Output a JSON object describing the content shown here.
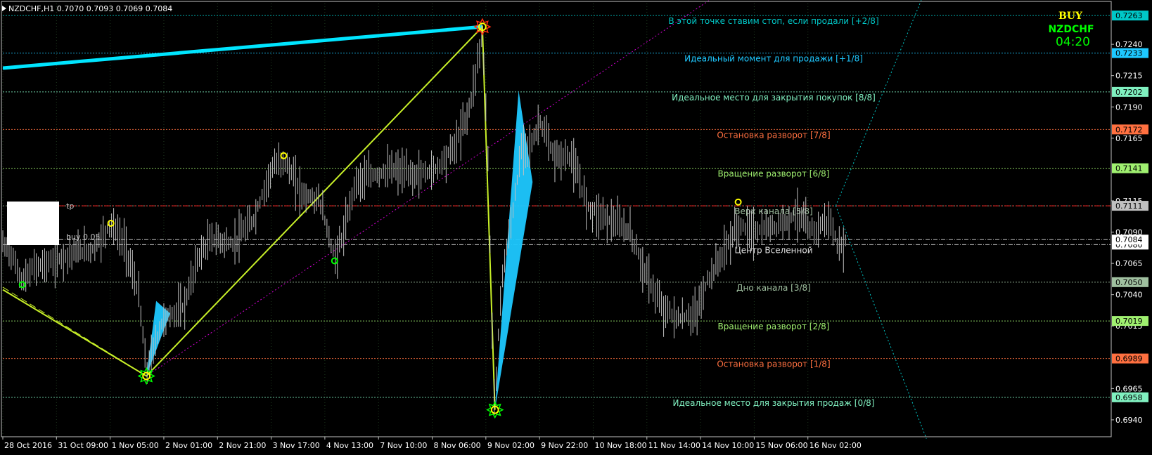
{
  "header": {
    "title": "NZDCHF,H1  0.7070 0.7093 0.7069 0.7084"
  },
  "signal": {
    "action": "BUY",
    "symbol": "NZDCHF",
    "timer": "04:20"
  },
  "trade_labels": {
    "tp": "tp",
    "buy": "buy 0.05"
  },
  "colors": {
    "background": "#000000",
    "bull_candle": "#c0c0c0",
    "grid": "#1f3a1f",
    "cyan": "#00e5ff",
    "sky": "#1ec8ff",
    "lime": "#c8f028",
    "orange": "#ff7040",
    "green_label": "#a0f070",
    "teal": "#00c8c8",
    "magenta": "#d000d0",
    "yellow": "#ffff00",
    "sig_green": "#00ff00",
    "buy_yellow": "#ffff00",
    "nzd_green": "#00ff00"
  },
  "chart_data": {
    "type": "line",
    "title": "NZDCHF,H1",
    "ylim": [
      0.69265,
      0.72726
    ],
    "x_range": [
      0,
      1237
    ],
    "x_tick_labels": [
      {
        "x": 0,
        "label": "28 Oct 2016"
      },
      {
        "x": 77,
        "label": "31 Oct 09:00"
      },
      {
        "x": 154,
        "label": "1 Nov 05:00"
      },
      {
        "x": 231,
        "label": "2 Nov 01:00"
      },
      {
        "x": 308,
        "label": "2 Nov 21:00"
      },
      {
        "x": 385,
        "label": "3 Nov 17:00"
      },
      {
        "x": 462,
        "label": "4 Nov 13:00"
      },
      {
        "x": 539,
        "label": "7 Nov 10:00"
      },
      {
        "x": 616,
        "label": "8 Nov 06:00"
      },
      {
        "x": 693,
        "label": "9 Nov 02:00"
      },
      {
        "x": 770,
        "label": "9 Nov 22:00"
      },
      {
        "x": 847,
        "label": "10 Nov 18:00"
      },
      {
        "x": 924,
        "label": "11 Nov 14:00"
      },
      {
        "x": 1001,
        "label": "14 Nov 10:00"
      },
      {
        "x": 1078,
        "label": "15 Nov 06:00"
      },
      {
        "x": 1155,
        "label": "16 Nov 02:00"
      }
    ],
    "y_tick_labels": [
      {
        "value": 0.724,
        "label": "0.7240"
      },
      {
        "value": 0.7215,
        "label": "0.7215"
      },
      {
        "value": 0.719,
        "label": "0.7190"
      },
      {
        "value": 0.7165,
        "label": "0.7165"
      },
      {
        "value": 0.7115,
        "label": "0.7115"
      },
      {
        "value": 0.709,
        "label": "0.7090"
      },
      {
        "value": 0.7065,
        "label": "0.7065"
      },
      {
        "value": 0.704,
        "label": "0.7040"
      },
      {
        "value": 0.7015,
        "label": "0.7015"
      },
      {
        "value": 0.6965,
        "label": "0.6965"
      },
      {
        "value": 0.694,
        "label": "0.6940"
      }
    ],
    "murrey_levels": [
      {
        "value": 0.7263,
        "label": "0.7263",
        "text": "В этой точке ставим стоп, если продали [+2/8]",
        "color": "#00c8c8",
        "tag_bg": "#00c8c8",
        "tag_fg": "#000000"
      },
      {
        "value": 0.7233,
        "label": "0.7233",
        "text": "Идеальный момент для продажи [+1/8]",
        "color": "#1ec8ff",
        "tag_bg": "#1ec8ff",
        "tag_fg": "#000000"
      },
      {
        "value": 0.7202,
        "label": "0.7202",
        "text": "Идеальное место для закрытия покупок [8/8]",
        "color": "#80f0c0",
        "tag_bg": "#80f0c0",
        "tag_fg": "#000000"
      },
      {
        "value": 0.7172,
        "label": "0.7172",
        "text": "Остановка разворот [7/8]",
        "color": "#ff7040",
        "tag_bg": "#ff7040",
        "tag_fg": "#000000"
      },
      {
        "value": 0.7141,
        "label": "0.7141",
        "text": "Вращение разворот [6/8]",
        "color": "#a0f070",
        "tag_bg": "#a0f070",
        "tag_fg": "#000000"
      },
      {
        "value": 0.7111,
        "label": "0.7111",
        "text": "Верх канала [5/8]",
        "color": "#a0c0a0",
        "tag_bg": "#c0c0c0",
        "tag_fg": "#000000"
      },
      {
        "value": 0.708,
        "label": "0.7080",
        "text": "Центр Вселенной",
        "color": "#e0e0e0",
        "tag_bg": "#ffffff",
        "tag_fg": "#000000"
      },
      {
        "value": 0.705,
        "label": "0.7050",
        "text": "Дно канала [3/8]",
        "color": "#a0c0a0",
        "tag_bg": "#a0c0a0",
        "tag_fg": "#000000"
      },
      {
        "value": 0.7019,
        "label": "0.7019",
        "text": "Вращение разворот [2/8]",
        "color": "#a0f070",
        "tag_bg": "#a0f070",
        "tag_fg": "#000000"
      },
      {
        "value": 0.6989,
        "label": "0.6989",
        "text": "Остановка разворот [1/8]",
        "color": "#ff7040",
        "tag_bg": "#ff7040",
        "tag_fg": "#000000"
      },
      {
        "value": 0.6958,
        "label": "0.6958",
        "text": "Идеальное место для закрытия продаж [0/8]",
        "color": "#80f0c0",
        "tag_bg": "#80f0c0",
        "tag_fg": "#000000"
      }
    ],
    "tp_level": 0.7111,
    "current_price": {
      "value": 0.7084,
      "label": "0.7084"
    },
    "zigzag": [
      {
        "x": 0,
        "y": 0.7044
      },
      {
        "x": 206,
        "y": 0.6975
      },
      {
        "x": 688,
        "y": 0.7254
      },
      {
        "x": 706,
        "y": 0.6948
      }
    ],
    "zigzag_dashed": [
      {
        "x": 0,
        "y": 0.7046
      },
      {
        "x": 206,
        "y": 0.6975
      }
    ],
    "trend_upper": [
      {
        "x": 0,
        "y": 0.7221
      },
      {
        "x": 688,
        "y": 0.7254
      }
    ],
    "magenta_channel": [
      {
        "x": 206,
        "y": 0.6975
      },
      {
        "x": 1040,
        "y": 0.7285
      }
    ],
    "teal_dotted": [
      {
        "x": 1195,
        "y": 0.7111
      },
      {
        "x": 1325,
        "y": 0.7285
      }
    ],
    "teal_dotted_down": [
      {
        "x": 1195,
        "y": 0.7111
      },
      {
        "x": 1325,
        "y": 0.6925
      }
    ],
    "fans": [
      {
        "x": [
          206,
          220,
          240
        ],
        "y": [
          0.6975,
          0.7035,
          0.7025
        ]
      },
      {
        "x": [
          706,
          740,
          760
        ],
        "y": [
          0.6948,
          0.7203,
          0.713
        ]
      }
    ],
    "signal_markers": [
      {
        "x": 28,
        "y": 0.7048,
        "kind": "green_circle"
      },
      {
        "x": 155,
        "y": 0.7097,
        "kind": "yellow_circle"
      },
      {
        "x": 206,
        "y": 0.6975,
        "kind": "green_star"
      },
      {
        "x": 403,
        "y": 0.7151,
        "kind": "yellow_circle"
      },
      {
        "x": 476,
        "y": 0.7067,
        "kind": "green_circle"
      },
      {
        "x": 688,
        "y": 0.7254,
        "kind": "red_star"
      },
      {
        "x": 706,
        "y": 0.6948,
        "kind": "green_star"
      },
      {
        "x": 1055,
        "y": 0.7114,
        "kind": "yellow_circle"
      }
    ],
    "price_path": [
      {
        "x": 0,
        "y": 0.708
      },
      {
        "x": 10,
        "y": 0.7075
      },
      {
        "x": 28,
        "y": 0.705
      },
      {
        "x": 45,
        "y": 0.7062
      },
      {
        "x": 70,
        "y": 0.7066
      },
      {
        "x": 100,
        "y": 0.7074
      },
      {
        "x": 130,
        "y": 0.7076
      },
      {
        "x": 155,
        "y": 0.7097
      },
      {
        "x": 175,
        "y": 0.708
      },
      {
        "x": 195,
        "y": 0.704
      },
      {
        "x": 206,
        "y": 0.6978
      },
      {
        "x": 215,
        "y": 0.6995
      },
      {
        "x": 230,
        "y": 0.702
      },
      {
        "x": 260,
        "y": 0.703
      },
      {
        "x": 280,
        "y": 0.707
      },
      {
        "x": 300,
        "y": 0.7085
      },
      {
        "x": 330,
        "y": 0.708
      },
      {
        "x": 360,
        "y": 0.71
      },
      {
        "x": 385,
        "y": 0.714
      },
      {
        "x": 403,
        "y": 0.7148
      },
      {
        "x": 430,
        "y": 0.712
      },
      {
        "x": 455,
        "y": 0.7115
      },
      {
        "x": 476,
        "y": 0.7069
      },
      {
        "x": 490,
        "y": 0.709
      },
      {
        "x": 505,
        "y": 0.713
      },
      {
        "x": 530,
        "y": 0.7135
      },
      {
        "x": 560,
        "y": 0.714
      },
      {
        "x": 590,
        "y": 0.7135
      },
      {
        "x": 620,
        "y": 0.714
      },
      {
        "x": 650,
        "y": 0.716
      },
      {
        "x": 670,
        "y": 0.719
      },
      {
        "x": 688,
        "y": 0.725
      },
      {
        "x": 696,
        "y": 0.715
      },
      {
        "x": 702,
        "y": 0.701
      },
      {
        "x": 706,
        "y": 0.695
      },
      {
        "x": 715,
        "y": 0.705
      },
      {
        "x": 730,
        "y": 0.71
      },
      {
        "x": 745,
        "y": 0.716
      },
      {
        "x": 760,
        "y": 0.716
      },
      {
        "x": 770,
        "y": 0.718
      },
      {
        "x": 790,
        "y": 0.715
      },
      {
        "x": 815,
        "y": 0.715
      },
      {
        "x": 840,
        "y": 0.711
      },
      {
        "x": 870,
        "y": 0.71
      },
      {
        "x": 900,
        "y": 0.709
      },
      {
        "x": 920,
        "y": 0.706
      },
      {
        "x": 945,
        "y": 0.703
      },
      {
        "x": 970,
        "y": 0.702
      },
      {
        "x": 995,
        "y": 0.7025
      },
      {
        "x": 1010,
        "y": 0.705
      },
      {
        "x": 1030,
        "y": 0.707
      },
      {
        "x": 1055,
        "y": 0.7095
      },
      {
        "x": 1080,
        "y": 0.709
      },
      {
        "x": 1110,
        "y": 0.7095
      },
      {
        "x": 1140,
        "y": 0.7105
      },
      {
        "x": 1160,
        "y": 0.709
      },
      {
        "x": 1185,
        "y": 0.71
      },
      {
        "x": 1200,
        "y": 0.7075
      },
      {
        "x": 1210,
        "y": 0.7084
      }
    ]
  }
}
